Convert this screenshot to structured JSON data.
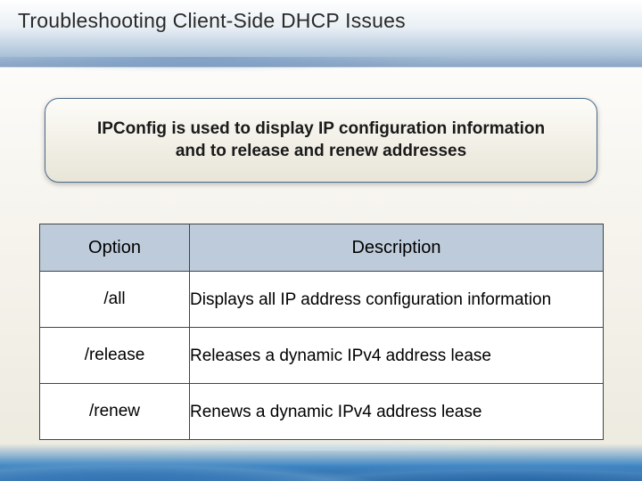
{
  "slide": {
    "title": "Troubleshooting Client-Side DHCP Issues",
    "callout": "IPConfig is used to display IP configuration information and to release and renew addresses"
  },
  "table": {
    "headers": {
      "option": "Option",
      "description": "Description"
    },
    "rows": [
      {
        "option": "/all",
        "description": "Displays all IP address configuration information"
      },
      {
        "option": "/release",
        "description": "Releases a dynamic IPv4 address lease"
      },
      {
        "option": "/renew",
        "description": "Renews a dynamic IPv4 address lease"
      }
    ]
  }
}
